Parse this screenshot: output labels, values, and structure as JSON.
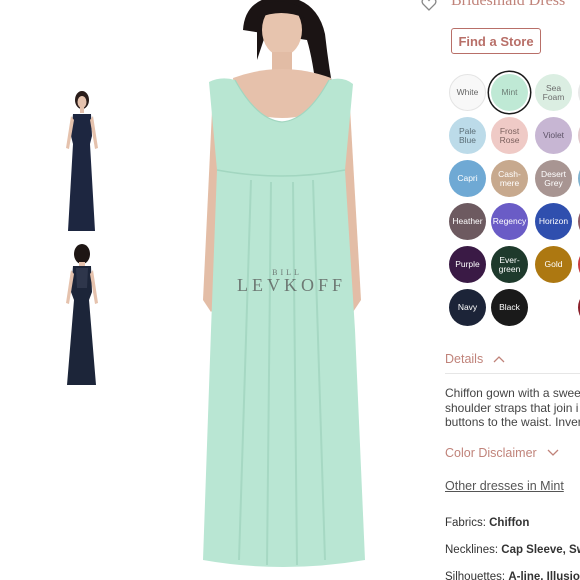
{
  "product": {
    "title": "Bridesmaid Dress",
    "find_store_label": "Find a Store",
    "watermark_small": "BILL",
    "watermark_big": "LEVKOFF"
  },
  "swatches": [
    {
      "label": "White",
      "color": "#f8f8f8",
      "text_color": "#666",
      "selected": false
    },
    {
      "label": "Mint",
      "color": "#bfe9d5",
      "text_color": "#6d7d75",
      "selected": true
    },
    {
      "label": "Sea Foam",
      "color": "#dbeee2",
      "text_color": "#6d6d6d",
      "selected": false
    },
    {
      "label": "Pale Blue",
      "color": "#bcdbe9",
      "text_color": "#5b6e77",
      "selected": false
    },
    {
      "label": "Frost Rose",
      "color": "#efcac6",
      "text_color": "#7b615e",
      "selected": false
    },
    {
      "label": "Violet",
      "color": "#c7b6d3",
      "text_color": "#5e5468",
      "selected": false
    },
    {
      "label": "Capri",
      "color": "#6fa9d4",
      "text_color": "#ffffff",
      "selected": false
    },
    {
      "label": "Cash-mere",
      "color": "#c7a98e",
      "text_color": "#ffffff",
      "selected": false
    },
    {
      "label": "Desert Grey",
      "color": "#a89592",
      "text_color": "#ffffff",
      "selected": false
    },
    {
      "label": "Heather",
      "color": "#6d5a60",
      "text_color": "#ffffff",
      "selected": false
    },
    {
      "label": "Regency",
      "color": "#6a5cc6",
      "text_color": "#ffffff",
      "selected": false
    },
    {
      "label": "Horizon",
      "color": "#2f4fae",
      "text_color": "#ffffff",
      "selected": false
    },
    {
      "label": "Purple",
      "color": "#3a1a45",
      "text_color": "#ffffff",
      "selected": false
    },
    {
      "label": "Ever-green",
      "color": "#1e3a2c",
      "text_color": "#ffffff",
      "selected": false
    },
    {
      "label": "Gold",
      "color": "#ad7811",
      "text_color": "#ffffff",
      "selected": false
    },
    {
      "label": "Navy",
      "color": "#1c2438",
      "text_color": "#ffffff",
      "selected": false
    },
    {
      "label": "Black",
      "color": "#1a1a1a",
      "text_color": "#ffffff",
      "selected": false
    }
  ],
  "partial_swatch_colors": [
    "#e8e8e8",
    "#e3c9cc",
    "#7fb2cf",
    "#8e5963",
    "#c93a40",
    "#8a1f2a"
  ],
  "details": {
    "label": "Details",
    "description_lines": [
      "Chiffon gown with a sweet",
      "shoulder straps that join i",
      "buttons to the waist. Inver"
    ]
  },
  "color_disclaimer": {
    "label": "Color Disclaimer"
  },
  "other_dresses_link": "Other dresses in Mint",
  "specs": [
    {
      "name": "Fabrics:",
      "value": "Chiffon"
    },
    {
      "name": "Necklines:",
      "value": "Cap Sleeve, Swe"
    },
    {
      "name": "Silhouettes:",
      "value": "A-line, Illusion"
    }
  ]
}
